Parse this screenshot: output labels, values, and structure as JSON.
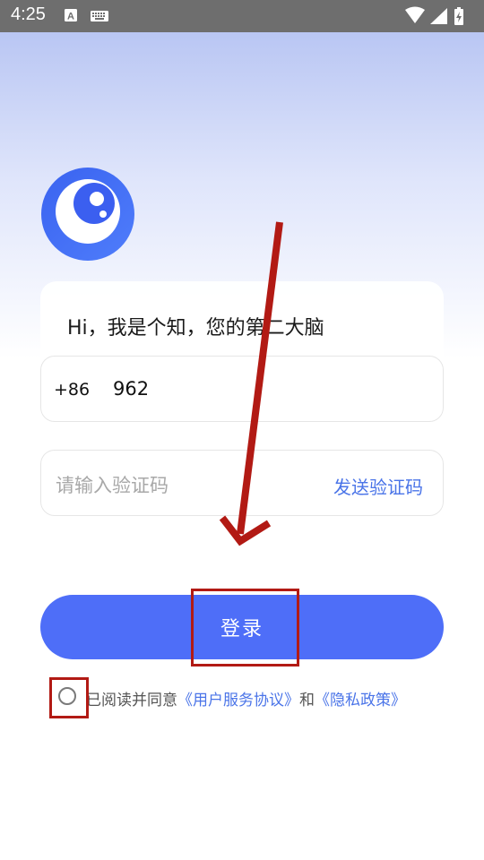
{
  "status_bar": {
    "time": "4:25",
    "icons": [
      "text-a-icon",
      "keyboard-icon",
      "wifi-icon",
      "cell-signal-icon",
      "battery-charging-icon"
    ]
  },
  "app": {
    "logo_icon": "eye-logo-icon",
    "greeting": "Hi，我是个知，您的第二大脑"
  },
  "login_form": {
    "country_code": "+86",
    "phone_value": "962",
    "code_placeholder": "请输入验证码",
    "send_code_label": "发送验证码",
    "login_label": "登录"
  },
  "agreement": {
    "checked": false,
    "prefix": "已阅读并同意",
    "user_agreement": "《用户服务协议》",
    "and": "和",
    "privacy_policy": "《隐私政策》"
  },
  "colors": {
    "accent": "#4e6ef8",
    "link": "#4a74e8",
    "annotation": "#b21a14"
  }
}
